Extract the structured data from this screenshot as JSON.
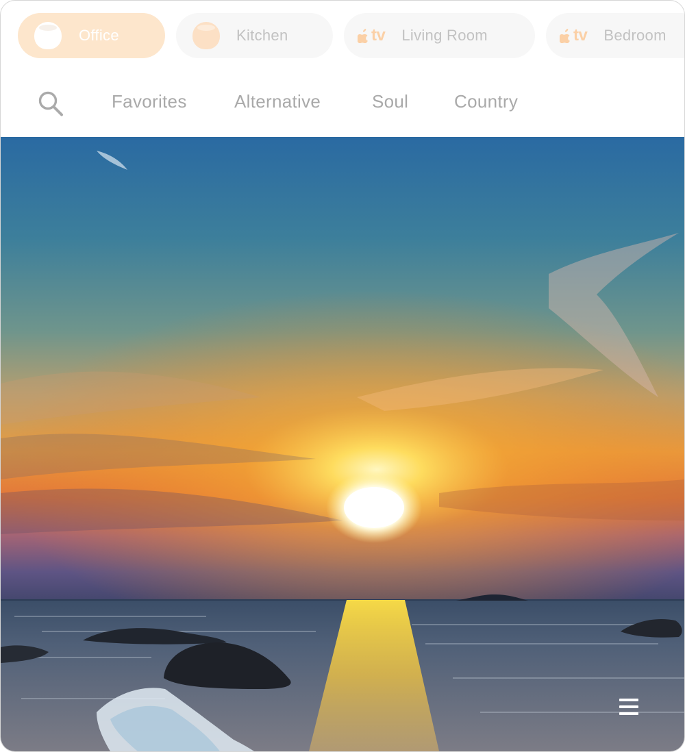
{
  "rooms": [
    {
      "label": "Office",
      "device": "homepod-icon",
      "active": true
    },
    {
      "label": "Kitchen",
      "device": "homepod-icon",
      "active": false
    },
    {
      "label": "Living Room",
      "device": "apple-tv-icon",
      "device_text": "tv",
      "active": false
    },
    {
      "label": "Bedroom",
      "device": "apple-tv-icon",
      "device_text": "tv",
      "active": false
    }
  ],
  "nav": {
    "search_icon": "search-icon",
    "genres": [
      "Favorites",
      "Alternative",
      "Soul",
      "Country"
    ]
  },
  "artwork": {
    "subject": "ocean-sunset-image",
    "menu_icon": "list-menu-icon"
  },
  "colors": {
    "accent": "#fde6cc",
    "accent_text": "#fbd0a6",
    "inactive_pill": "#f7f7f7",
    "nav_text": "#a9a9a9"
  }
}
